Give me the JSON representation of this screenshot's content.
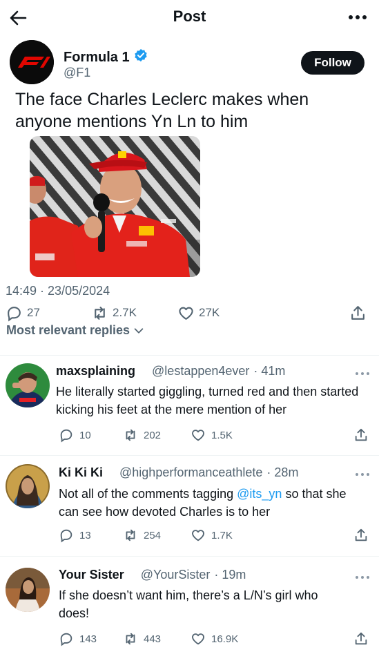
{
  "header": {
    "title": "Post"
  },
  "post": {
    "author_name": "Formula 1",
    "author_handle": "@F1",
    "follow_label": "Follow",
    "text": "The face Charles Leclerc makes when anyone mentions Yn Ln to him",
    "timestamp": "14:49 · 23/05/2024",
    "replies": "27",
    "reposts": "2.7K",
    "likes": "27K",
    "brand_color": "#e10600",
    "verified_color": "#1d9bf0"
  },
  "sort": {
    "label": "Most relevant replies"
  },
  "replies": [
    {
      "name": "maxsplaining",
      "handle": "@lestappen4ever",
      "time": "· 41m",
      "text": "He literally started giggling, turned red and then started kicking his feet at the mere mention of her",
      "replies": "10",
      "reposts": "202",
      "likes": "1.5K"
    },
    {
      "name": "Ki Ki Ki",
      "handle": "@highperformanceathlete",
      "time": "· 28m",
      "text_before": "Not all of the comments tagging ",
      "mention": "@its_yn",
      "text_after": " so that she can see how devoted Charles is to her",
      "replies": "13",
      "reposts": "254",
      "likes": "1.7K"
    },
    {
      "name": "Your Sister",
      "handle": "@YourSister",
      "time": "· 19m",
      "text": "If she doesn’t want him, there’s a L/N’s girl who does!",
      "replies": "143",
      "reposts": "443",
      "likes": "16.9K"
    }
  ]
}
